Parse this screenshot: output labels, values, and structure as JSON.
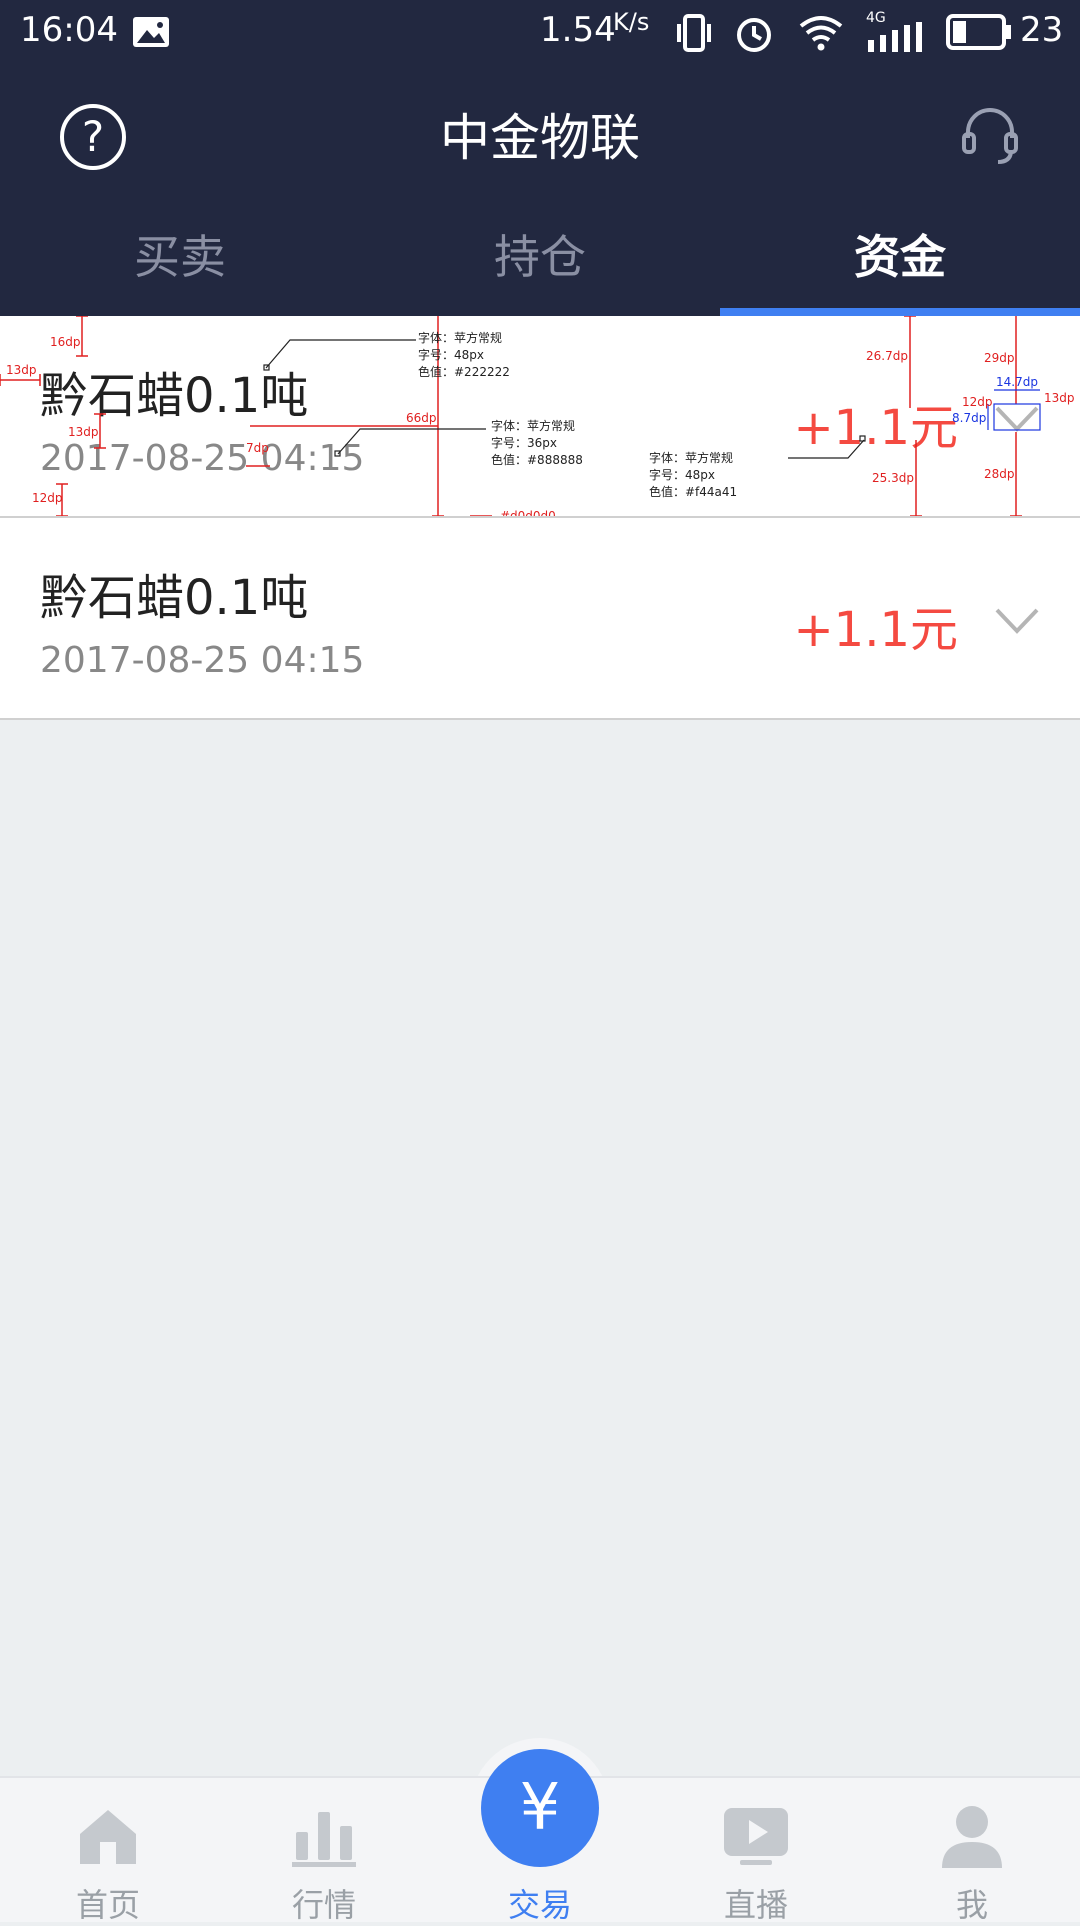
{
  "status_bar": {
    "time": "16:04",
    "net_speed": "1.54",
    "net_unit": "K/s",
    "network": "4G",
    "battery": "23"
  },
  "header": {
    "title": "中金物联",
    "help_icon": "help-circle-icon",
    "service_icon": "headset-icon"
  },
  "tabs": [
    {
      "label": "买卖",
      "active": false
    },
    {
      "label": "持仓",
      "active": false
    },
    {
      "label": "资金",
      "active": true
    }
  ],
  "records": [
    {
      "name": "黔石蜡0.1吨",
      "date": "2017-08-25  04:15",
      "amount": "+1.1元"
    },
    {
      "name": "黔石蜡0.1吨",
      "date": "2017-08-25  04:15",
      "amount": "+1.1元"
    }
  ],
  "annotations": {
    "spec_name": [
      "字体：苹方常规",
      "字号：48px",
      "色值：#222222"
    ],
    "spec_date": [
      "字体：苹方常规",
      "字号：36px",
      "色值：#888888"
    ],
    "spec_amount": [
      "字体：苹方常规",
      "字号：48px",
      "色值：#f44a41"
    ],
    "divider_color": "#d0d0d0",
    "dims": {
      "top": "16dp",
      "left": "13dp",
      "gap": "13dp",
      "bottom": "12dp",
      "date_gap": "7dp",
      "name_offset": "66dp",
      "amt_top": "26.7dp",
      "amt_bottom": "25.3dp",
      "chev_top": "29dp",
      "chev_bottom": "28dp",
      "chev_width": "14.7dp",
      "chev_right": "13dp",
      "chev_gap": "12dp",
      "chev_height": "8.7dp"
    }
  },
  "tabbar": [
    {
      "label": "首页",
      "icon": "home-icon",
      "active": false
    },
    {
      "label": "行情",
      "icon": "chart-bars-icon",
      "active": false
    },
    {
      "label": "交易",
      "icon": "yen-icon",
      "active": true
    },
    {
      "label": "直播",
      "icon": "play-icon",
      "active": false
    },
    {
      "label": "我",
      "icon": "user-icon",
      "active": false
    }
  ],
  "colors": {
    "header_bg": "#222840",
    "accent": "#3f7ff1",
    "amount": "#f44a41",
    "page_bg": "#eceff1"
  }
}
